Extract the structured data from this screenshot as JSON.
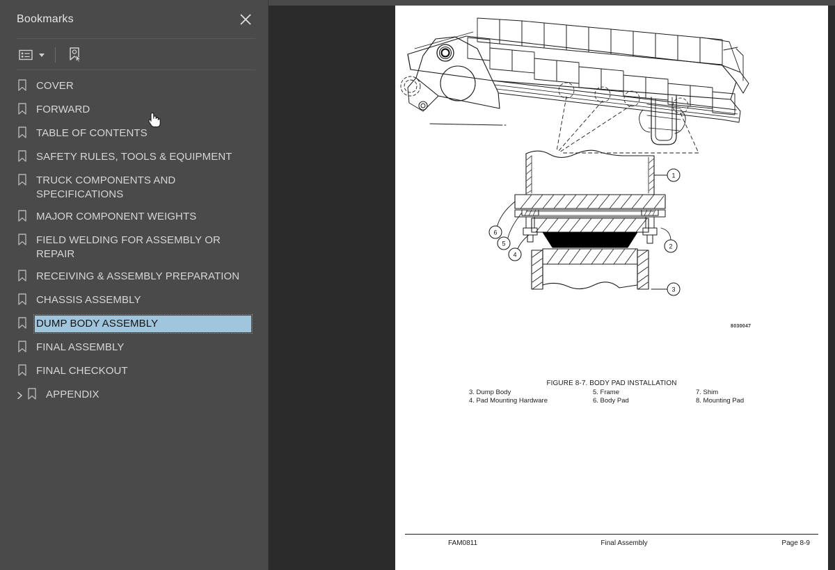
{
  "sidebar": {
    "title": "Bookmarks",
    "close_icon": "close-icon",
    "toolbar": {
      "options_icon": "list-options-icon",
      "new_bookmark_icon": "new-bookmark-icon"
    },
    "items": [
      {
        "label": "COVER",
        "selected": false,
        "expandable": false
      },
      {
        "label": "FORWARD",
        "selected": false,
        "expandable": false
      },
      {
        "label": "TABLE OF CONTENTS",
        "selected": false,
        "expandable": false
      },
      {
        "label": "SAFETY RULES, TOOLS & EQUIPMENT",
        "selected": false,
        "expandable": false
      },
      {
        "label": "TRUCK COMPONENTS AND SPECIFICATIONS",
        "selected": false,
        "expandable": false
      },
      {
        "label": "MAJOR COMPONENT WEIGHTS",
        "selected": false,
        "expandable": false
      },
      {
        "label": "FIELD WELDING FOR ASSEMBLY OR REPAIR",
        "selected": false,
        "expandable": false
      },
      {
        "label": "RECEIVING & ASSEMBLY PREPARATION",
        "selected": false,
        "expandable": false
      },
      {
        "label": "CHASSIS ASSEMBLY",
        "selected": false,
        "expandable": false
      },
      {
        "label": "DUMP BODY ASSEMBLY",
        "selected": true,
        "expandable": false
      },
      {
        "label": "FINAL ASSEMBLY",
        "selected": false,
        "expandable": false
      },
      {
        "label": "FINAL CHECKOUT",
        "selected": false,
        "expandable": false
      },
      {
        "label": "APPENDIX",
        "selected": false,
        "expandable": true
      }
    ],
    "collapse_arrow_icon": "collapse-panel-arrow-icon",
    "highlight_color": "#9fc6dd",
    "background_color": "#4a4a4a",
    "text_color": "#d6d6d6"
  },
  "viewer": {
    "background_color": "#2b2b2b",
    "page": {
      "figure": {
        "caption": "FIGURE 8-7. BODY PAD INSTALLATION",
        "drawing_code": "8030047",
        "callouts": [
          "1",
          "2",
          "3",
          "4",
          "5",
          "6"
        ],
        "legend_columns": [
          [
            "3. Dump Body",
            "4. Pad Mounting Hardware"
          ],
          [
            "5. Frame",
            "6. Body Pad"
          ],
          [
            "7. Shim",
            "8. Mounting Pad"
          ]
        ]
      },
      "footer": {
        "document_number": "FAM0811",
        "section": "Final Assembly",
        "page_number": "Page 8-9"
      }
    }
  },
  "cursor": {
    "type": "pointing-hand"
  }
}
